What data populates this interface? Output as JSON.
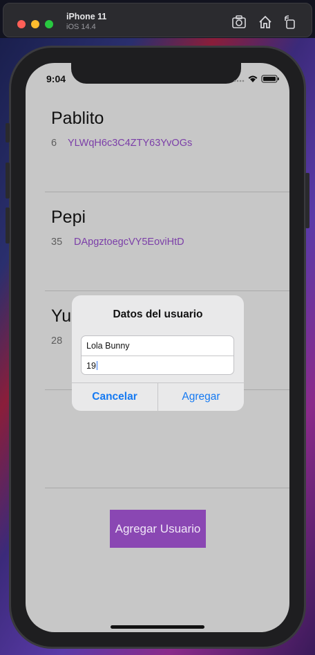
{
  "simulator": {
    "device_name": "iPhone 11",
    "os_version": "iOS 14.4"
  },
  "status_bar": {
    "time": "9:04"
  },
  "users": [
    {
      "name": "Pablito",
      "age": "6",
      "id": "YLWqH6c3C4ZTY63YvOGs"
    },
    {
      "name": "Pepi",
      "age": "35",
      "id": "DApgztoegcVY5EoviHtD"
    },
    {
      "name": "Yu",
      "age": "28",
      "id": ""
    }
  ],
  "add_user_button": "Agregar Usuario",
  "alert": {
    "title": "Datos del usuario",
    "name_value": "Lola Bunny",
    "age_value": "19",
    "cancel_label": "Cancelar",
    "add_label": "Agregar"
  },
  "colors": {
    "accent_purple": "#8a47b3",
    "id_text": "#7b3ea8",
    "ios_blue": "#1479f2",
    "screen_bg": "#c7c7c7"
  }
}
